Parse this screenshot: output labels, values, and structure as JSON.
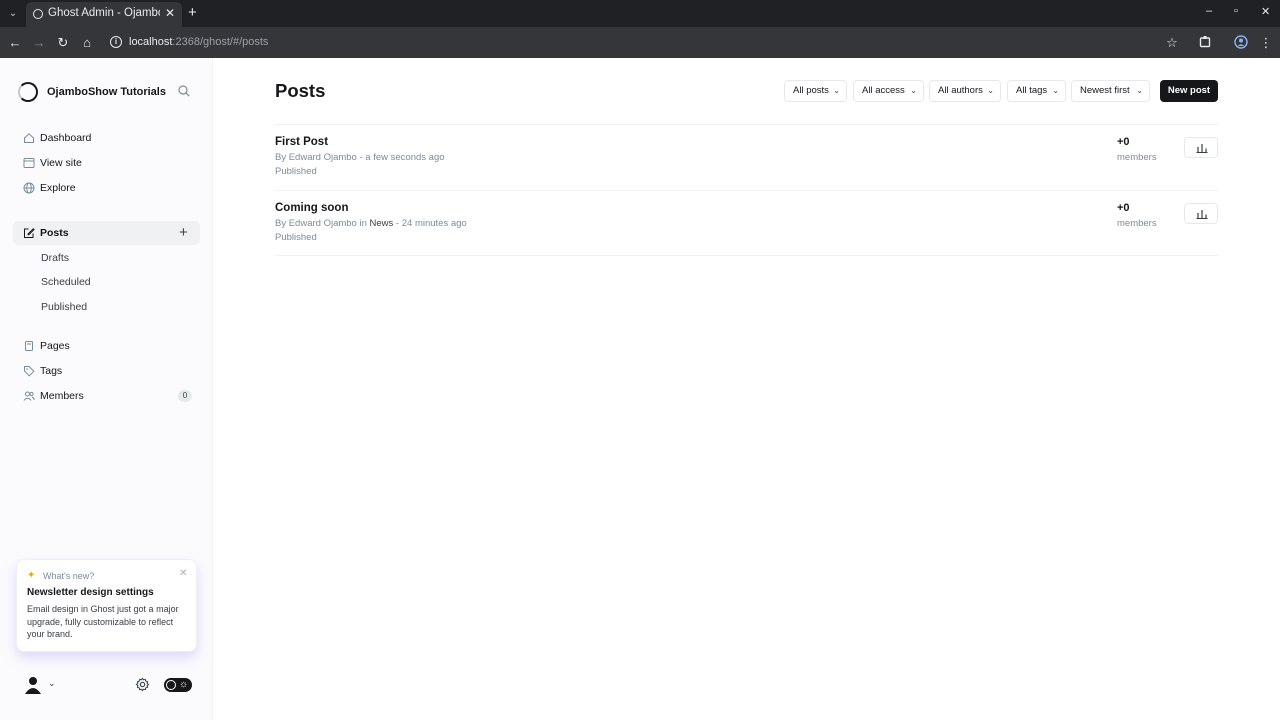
{
  "browser": {
    "tab_title": "Ghost Admin - OjamboShow Tutorials",
    "url_host": "localhost",
    "url_path": ":2368/ghost/#/posts"
  },
  "sidebar": {
    "site_name": "OjamboShow Tutorials",
    "nav": [
      {
        "label": "Dashboard",
        "icon": "home-icon"
      },
      {
        "label": "View site",
        "icon": "window-icon"
      },
      {
        "label": "Explore",
        "icon": "globe-icon"
      }
    ],
    "posts_label": "Posts",
    "post_filters": [
      "Drafts",
      "Scheduled",
      "Published"
    ],
    "pages_label": "Pages",
    "tags_label": "Tags",
    "members_label": "Members",
    "members_count": "0"
  },
  "whats_new": {
    "tag": "What's new?",
    "title": "Newsletter design settings",
    "body": "Email design in Ghost just got a major upgrade, fully customizable to reflect your brand."
  },
  "main": {
    "title": "Posts",
    "filters": [
      "All posts",
      "All access",
      "All authors",
      "All tags",
      "Newest first"
    ],
    "new_post_label": "New post",
    "posts": [
      {
        "title": "First Post",
        "meta_prefix": "By Edward Ojambo",
        "tag": "",
        "time": "a few seconds ago",
        "status": "Published",
        "member_delta": "+0",
        "member_label": "members"
      },
      {
        "title": "Coming soon",
        "meta_prefix": "By Edward Ojambo",
        "tag": "News",
        "time": "24 minutes ago",
        "status": "Published",
        "member_delta": "+0",
        "member_label": "members"
      }
    ]
  },
  "colors": {
    "sidebar_bg": "#fbfbfd",
    "primary_button": "#15171a",
    "accent_spark": "#f0a500"
  }
}
